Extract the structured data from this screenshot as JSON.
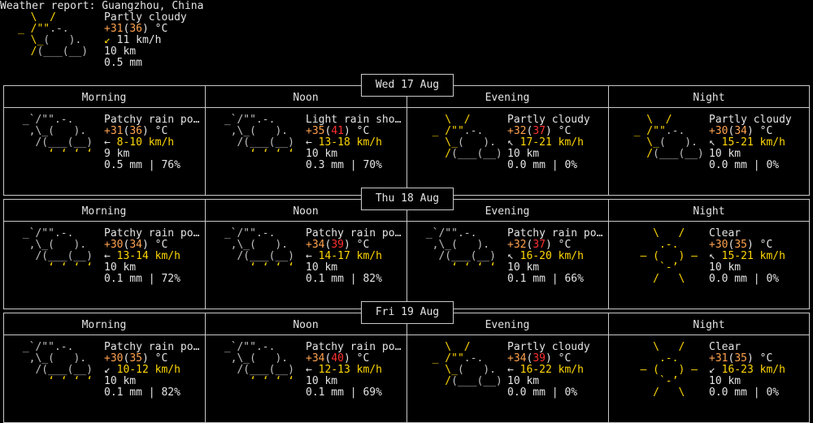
{
  "report": {
    "title": "Weather report: Guangzhou, China",
    "current": {
      "desc": "Partly cloudy",
      "temp": "+31",
      "feels": "36",
      "unit": " °C",
      "wind_arrow": "↙",
      "wind": "11 km/h",
      "visibility": "10 km",
      "precip": "0.5 mm"
    }
  },
  "days": [
    {
      "date": "Wed 17 Aug",
      "periods": [
        {
          "name": "Morning",
          "icon": "rain",
          "desc": "Patchy rain po…",
          "temp": "+31",
          "feels": "36",
          "temp_color": "o",
          "feels_color": "o",
          "arrow": "←",
          "wind": "8-10 km/h",
          "vis": "9 km",
          "precip": "0.5 mm | 76%"
        },
        {
          "name": "Noon",
          "icon": "rain",
          "desc": "Light rain sho…",
          "temp": "+35",
          "feels": "41",
          "temp_color": "o",
          "feels_color": "r",
          "arrow": "←",
          "wind": "13-18 km/h",
          "vis": "10 km",
          "precip": "0.3 mm | 70%"
        },
        {
          "name": "Evening",
          "icon": "partly",
          "desc": "Partly cloudy",
          "temp": "+32",
          "feels": "37",
          "temp_color": "o",
          "feels_color": "r",
          "arrow": "↖",
          "wind": "17-21 km/h",
          "vis": "10 km",
          "precip": "0.0 mm | 0%"
        },
        {
          "name": "Night",
          "icon": "partly",
          "desc": "Partly cloudy",
          "temp": "+30",
          "feels": "34",
          "temp_color": "o",
          "feels_color": "o",
          "arrow": "↖",
          "wind": "15-21 km/h",
          "vis": "10 km",
          "precip": "0.0 mm | 0%"
        }
      ]
    },
    {
      "date": "Thu 18 Aug",
      "periods": [
        {
          "name": "Morning",
          "icon": "rain",
          "desc": "Patchy rain po…",
          "temp": "+30",
          "feels": "34",
          "temp_color": "o",
          "feels_color": "o",
          "arrow": "←",
          "wind": "13-14 km/h",
          "vis": "10 km",
          "precip": "0.1 mm | 72%"
        },
        {
          "name": "Noon",
          "icon": "rain",
          "desc": "Patchy rain po…",
          "temp": "+34",
          "feels": "39",
          "temp_color": "o",
          "feels_color": "r",
          "arrow": "←",
          "wind": "14-17 km/h",
          "vis": "10 km",
          "precip": "0.1 mm | 82%"
        },
        {
          "name": "Evening",
          "icon": "rain",
          "desc": "Patchy rain po…",
          "temp": "+32",
          "feels": "37",
          "temp_color": "o",
          "feels_color": "r",
          "arrow": "↖",
          "wind": "16-20 km/h",
          "vis": "10 km",
          "precip": "0.1 mm | 66%"
        },
        {
          "name": "Night",
          "icon": "clear",
          "desc": "Clear",
          "temp": "+30",
          "feels": "35",
          "temp_color": "o",
          "feels_color": "o",
          "arrow": "↖",
          "wind": "15-21 km/h",
          "vis": "10 km",
          "precip": "0.0 mm | 0%"
        }
      ]
    },
    {
      "date": "Fri 19 Aug",
      "periods": [
        {
          "name": "Morning",
          "icon": "rain",
          "desc": "Patchy rain po…",
          "temp": "+30",
          "feels": "35",
          "temp_color": "o",
          "feels_color": "o",
          "arrow": "↙",
          "wind": "10-12 km/h",
          "vis": "10 km",
          "precip": "0.1 mm | 82%"
        },
        {
          "name": "Noon",
          "icon": "rain",
          "desc": "Patchy rain po…",
          "temp": "+34",
          "feels": "40",
          "temp_color": "o",
          "feels_color": "r",
          "arrow": "←",
          "wind": "12-13 km/h",
          "vis": "10 km",
          "precip": "0.1 mm | 69%"
        },
        {
          "name": "Evening",
          "icon": "partly",
          "desc": "Partly cloudy",
          "temp": "+34",
          "feels": "39",
          "temp_color": "o",
          "feels_color": "r",
          "arrow": "←",
          "wind": "16-22 km/h",
          "vis": "10 km",
          "precip": "0.0 mm | 0%"
        },
        {
          "name": "Night",
          "icon": "clear",
          "desc": "Clear",
          "temp": "+31",
          "feels": "35",
          "temp_color": "o",
          "feels_color": "o",
          "arrow": "↙",
          "wind": "16-23 km/h",
          "vis": "10 km",
          "precip": "0.0 mm | 0%"
        }
      ]
    }
  ],
  "icon_names": {
    "rain": "patchy-rain-icon",
    "partly": "partly-cloudy-icon",
    "clear": "clear-sun-icon"
  },
  "colors": {
    "sun": "#ffd700",
    "cloud": "#c0c0c0",
    "warm": "#ffa34f",
    "hot": "#ff3030"
  }
}
